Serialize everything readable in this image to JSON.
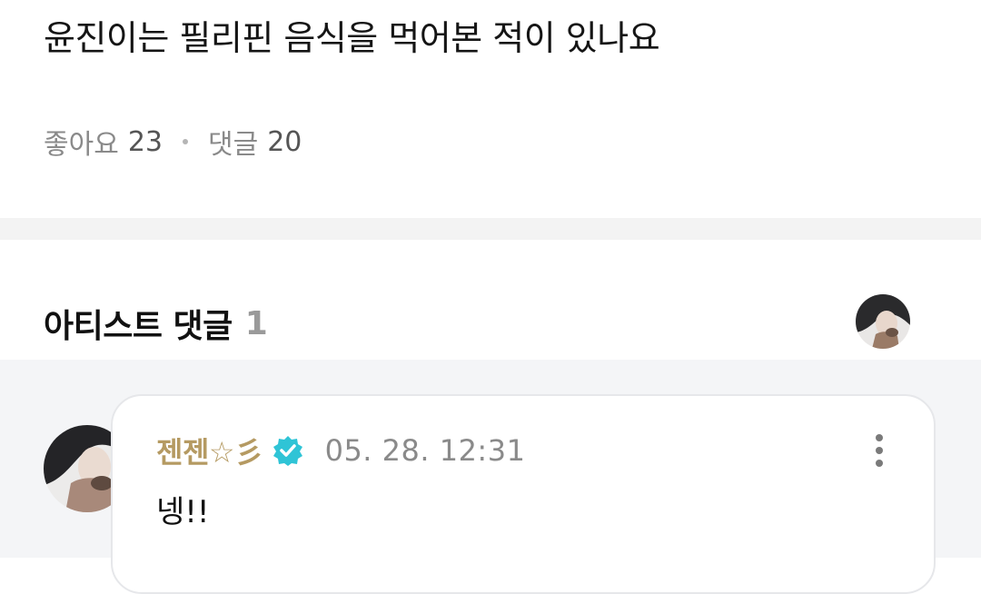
{
  "post": {
    "title": "윤진이는 필리핀 음식을 먹어본 적이 있나요",
    "likes_label": "좋아요",
    "likes_count": "23",
    "comments_label": "댓글",
    "comments_count": "20"
  },
  "artist_comments": {
    "title": "아티스트 댓글",
    "count": "1",
    "header_avatar_icon": "artist-avatar-icon"
  },
  "comments": [
    {
      "author": "젠젠☆彡",
      "verified_icon": "verified-badge-icon",
      "timestamp": "05. 28. 12:31",
      "text": "넹!!",
      "menu_icon": "more-vertical-icon"
    }
  ],
  "colors": {
    "author_name": "#b59a62",
    "verified_badge": "#2fc4d6",
    "muted_text": "#8a8a8a",
    "comments_background": "#f4f5f7",
    "separator": "#f3f3f3"
  }
}
